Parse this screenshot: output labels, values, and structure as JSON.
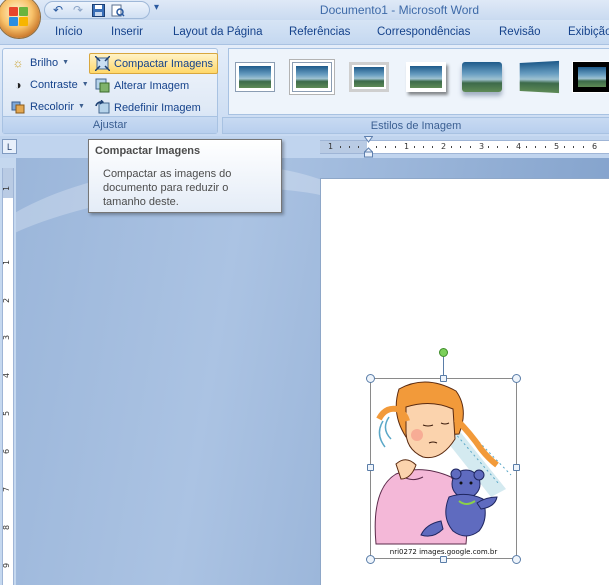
{
  "window": {
    "title": "Documento1 - Microsoft Word"
  },
  "quick_access": {
    "more_glyph": "▾"
  },
  "tabs": [
    {
      "label": "Início"
    },
    {
      "label": "Inserir"
    },
    {
      "label": "Layout da Página"
    },
    {
      "label": "Referências"
    },
    {
      "label": "Correspondências"
    },
    {
      "label": "Revisão"
    },
    {
      "label": "Exibição"
    }
  ],
  "ribbon": {
    "adjust_group": {
      "label": "Ajustar",
      "brightness": "Brilho",
      "contrast": "Contraste",
      "recolor": "Recolorir",
      "compress": "Compactar Imagens",
      "change": "Alterar Imagem",
      "reset": "Redefinir Imagem"
    },
    "styles_group": {
      "label": "Estilos de Imagem"
    }
  },
  "ruler": {
    "tab_glyph": "L",
    "h_numbers": [
      "1",
      "1",
      "2",
      "3",
      "4",
      "5",
      "6"
    ],
    "v_numbers": [
      "1",
      "1",
      "2",
      "3",
      "4",
      "5",
      "6",
      "7",
      "8",
      "9"
    ]
  },
  "tooltip": {
    "title": "Compactar Imagens",
    "body": "Compactar as imagens do documento para reduzir o tamanho deste."
  },
  "picture": {
    "caption": "nri0272  images.google.com.br"
  }
}
